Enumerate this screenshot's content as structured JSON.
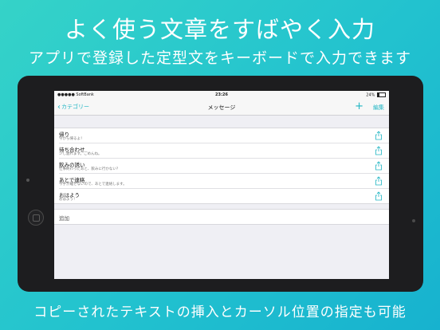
{
  "headline": {
    "title": "よく使う文章をすばやく入力",
    "subtitle": "アプリで登録した定型文をキーボードで入力できます",
    "footer": "コピーされたテキストの挿入とカーソル位置の指定も可能"
  },
  "status_bar": {
    "carrier": "●●●●● SoftBank",
    "time": "23:26",
    "battery": "24%"
  },
  "nav": {
    "back_label": "カテゴリー",
    "title": "メッセージ",
    "add_label": "+",
    "edit_label": "編集"
  },
  "items": [
    {
      "title": "帰り",
      "subtitle": "今から帰るよ！"
    },
    {
      "title": "待ち合わせ",
      "subtitle": "少し遅れます。ごめんね。"
    },
    {
      "title": "飲みの誘い",
      "subtitle": "仕事終わったあと、飲みに行かない？"
    },
    {
      "title": "あとで連絡",
      "subtitle": "今手が離せないので、あとで連絡します。"
    },
    {
      "title": "おはよう",
      "subtitle": "おはよう！"
    }
  ],
  "add_row": {
    "label": "追加"
  },
  "colors": {
    "accent": "#1fb5c3",
    "background_start": "#35d3c8",
    "background_end": "#17b2cf"
  }
}
